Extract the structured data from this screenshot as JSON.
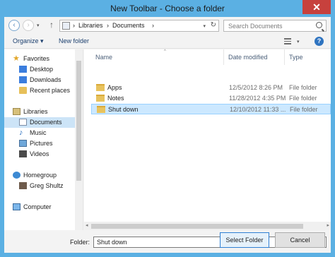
{
  "window": {
    "title": "New Toolbar - Choose a folder",
    "close": "✕"
  },
  "nav": {
    "back": "‹",
    "forward": "›",
    "recent_dropdown": "▾",
    "up": "↑",
    "breadcrumbs": [
      "Libraries",
      "Documents"
    ],
    "separator": "›",
    "address_dropdown": "▾",
    "refresh": "↻",
    "search_placeholder": "Search Documents"
  },
  "toolbar": {
    "organize": "Organize ▾",
    "new_folder": "New folder",
    "view_dropdown": "▾",
    "help": "?"
  },
  "navpane": {
    "favorites": {
      "label": "Favorites",
      "icon": "star-icon",
      "items": [
        {
          "label": "Desktop",
          "icon": "desktop-icon"
        },
        {
          "label": "Downloads",
          "icon": "downloads-icon"
        },
        {
          "label": "Recent places",
          "icon": "recent-places-icon"
        }
      ]
    },
    "libraries": {
      "label": "Libraries",
      "icon": "library-icon",
      "items": [
        {
          "label": "Documents",
          "icon": "documents-icon",
          "selected": true
        },
        {
          "label": "Music",
          "icon": "music-icon"
        },
        {
          "label": "Pictures",
          "icon": "pictures-icon"
        },
        {
          "label": "Videos",
          "icon": "videos-icon"
        }
      ]
    },
    "homegroup": {
      "label": "Homegroup",
      "icon": "homegroup-icon",
      "items": [
        {
          "label": "Greg Shultz",
          "icon": "user-icon"
        }
      ]
    },
    "computer": {
      "label": "Computer",
      "icon": "computer-icon"
    }
  },
  "filelist": {
    "columns": {
      "name": "Name",
      "date": "Date modified",
      "type": "Type",
      "sort_indicator": "^"
    },
    "rows": [
      {
        "name": "Apps",
        "date": "12/5/2012 8:26 PM",
        "type": "File folder",
        "selected": false
      },
      {
        "name": "Notes",
        "date": "11/28/2012 4:35 PM",
        "type": "File folder",
        "selected": false
      },
      {
        "name": "Shut down",
        "date": "12/10/2012 11:33 ...",
        "type": "File folder",
        "selected": true
      }
    ]
  },
  "hscroll": {
    "left": "◂",
    "right": "▸"
  },
  "bottom": {
    "folder_label": "Folder:",
    "folder_value": "Shut down",
    "select_button": "Select Folder",
    "cancel_button": "Cancel"
  },
  "colors": {
    "titlebar": "#5bb0e3",
    "close": "#c7413d",
    "selection": "#cce8ff"
  }
}
